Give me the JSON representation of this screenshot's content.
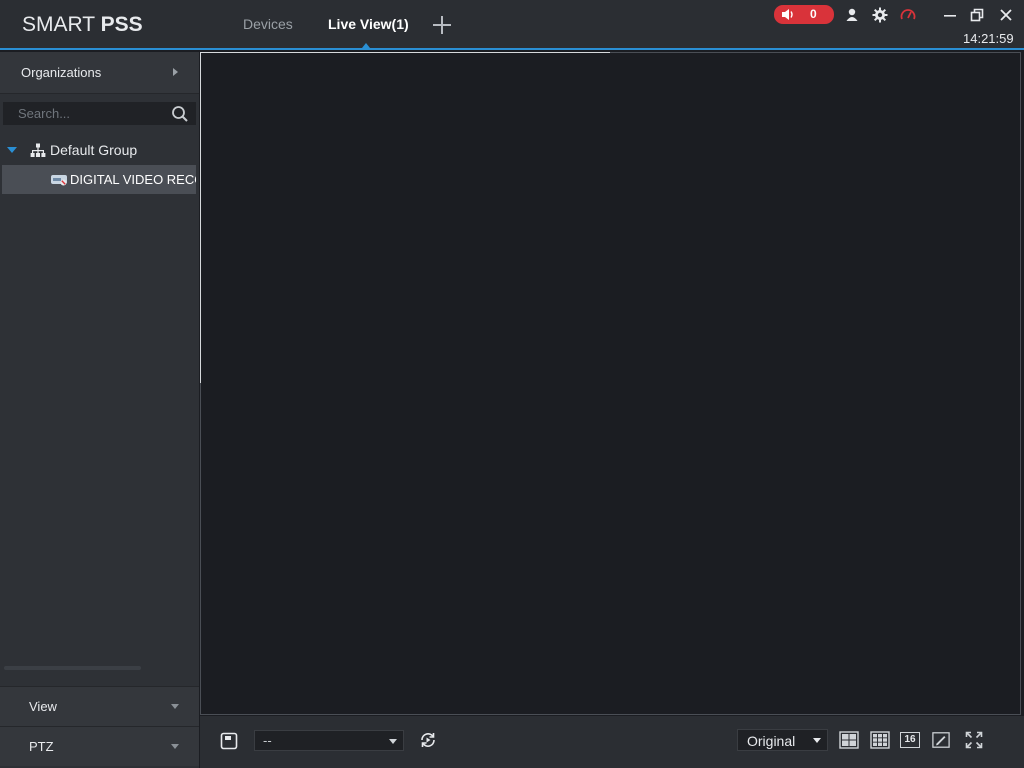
{
  "app": {
    "logo_light": "SMART ",
    "logo_bold": "PSS",
    "tabs": [
      {
        "label": "Devices"
      },
      {
        "label": "Live View(1)"
      }
    ],
    "alarm_count": "0",
    "clock": "14:21:59",
    "alarm_color": "#d9333a",
    "accent": "#2a8fd4"
  },
  "sidebar": {
    "organizations_label": "Organizations",
    "search_placeholder": "Search...",
    "tree": {
      "group_label": "Default Group",
      "device_label": "DIGITAL VIDEO RECORDER"
    },
    "panels": [
      {
        "label": "View"
      },
      {
        "label": "PTZ"
      }
    ]
  },
  "toolbar": {
    "view_select_value": "--",
    "ratio_value": "Original",
    "layout16_label": "16"
  },
  "icons": {
    "alarm": "speaker-icon",
    "user": "user-icon",
    "settings": "gear-icon",
    "performance": "speedometer-icon",
    "group": "org-tree-icon",
    "device": "dvr-icon"
  }
}
